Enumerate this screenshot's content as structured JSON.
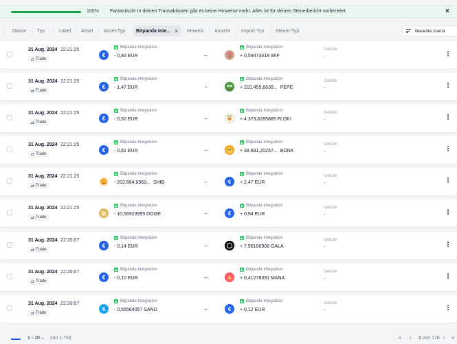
{
  "banner": {
    "progress_percent": 100,
    "progress_label": "100%",
    "message": "Fantastisch! In deinen Transaktionen gibt es keine Hinweise mehr. Alles ist für deinen Steuerbericht vorbereitet.",
    "close": "×"
  },
  "filters": {
    "items": [
      "Datum",
      "Typ",
      "Label",
      "Asset",
      "Asset-Typ"
    ],
    "active": {
      "label": "Bitpanda Inte...",
      "clear": "×"
    },
    "items_after": [
      "Hinweis",
      "Ansicht",
      "Import-Typ",
      "Steuer-Typ"
    ],
    "sort_label": "Neueste zuerst"
  },
  "common": {
    "source": "Bitpanda Integration",
    "tag": "Trade",
    "fee_label": "Gebühr",
    "fee_value": "-",
    "arrow": "→"
  },
  "rows": [
    {
      "date": "31 Aug. 2024",
      "time": "22:21:25",
      "from_icon": "EUR",
      "from_amount": "- 0,83 EUR",
      "from_sym": "",
      "to_icon": "WIF",
      "to_amount": "+ 0,59473418 WIF",
      "to_sym": ""
    },
    {
      "date": "31 Aug. 2024",
      "time": "22:21:25",
      "from_icon": "EUR",
      "from_amount": "- 1,47 EUR",
      "from_sym": "",
      "to_icon": "PEPE",
      "to_amount": "+ 210.455,6635...",
      "to_sym": "PEPE"
    },
    {
      "date": "31 Aug. 2024",
      "time": "22:21:25",
      "from_icon": "EUR",
      "from_amount": "- 0,50 EUR",
      "from_sym": "",
      "to_icon": "FLOKI",
      "to_amount": "+ 4.373,6285885 FLOKI",
      "to_sym": ""
    },
    {
      "date": "31 Aug. 2024",
      "time": "22:21:25",
      "from_icon": "EUR",
      "from_amount": "- 0,61 EUR",
      "from_sym": "",
      "to_icon": "BONK",
      "to_amount": "+ 38.691,20257...",
      "to_sym": "BONK"
    },
    {
      "date": "31 Aug. 2024",
      "time": "22:21:25",
      "from_icon": "SHIB",
      "from_amount": "- 202.684,0563...",
      "from_sym": "SHIB",
      "to_icon": "EUR",
      "to_amount": "+ 2,47 EUR",
      "to_sym": ""
    },
    {
      "date": "31 Aug. 2024",
      "time": "22:21:25",
      "from_icon": "DOGE",
      "from_amount": "- 10,56923995 DOGE",
      "from_sym": "",
      "to_icon": "EUR",
      "to_amount": "+ 0,94 EUR",
      "to_sym": ""
    },
    {
      "date": "31 Aug. 2024",
      "time": "22:20:07",
      "from_icon": "EUR",
      "from_amount": "- 0,14 EUR",
      "from_sym": "",
      "to_icon": "GALA",
      "to_amount": "+ 7,96196908 GALA",
      "to_sym": ""
    },
    {
      "date": "31 Aug. 2024",
      "time": "22:20:07",
      "from_icon": "EUR",
      "from_amount": "- 0,10 EUR",
      "from_sym": "",
      "to_icon": "MANA",
      "to_amount": "+ 0,41278391 MANA",
      "to_sym": ""
    },
    {
      "date": "31 Aug. 2024",
      "time": "22:20:07",
      "from_icon": "SAND",
      "from_amount": "- 0,55564057 SAND",
      "from_sym": "",
      "to_icon": "EUR",
      "to_amount": "+ 0,12 EUR",
      "to_sym": ""
    }
  ],
  "footer": {
    "per_page": "1 - 10",
    "per_page_chevron": "⌄",
    "range": "von 1.754",
    "first": "«",
    "prev": "‹",
    "page": "1",
    "page_of": "von 176",
    "next": "›",
    "last": "»"
  },
  "colors": {
    "accent": "#2563eb",
    "success": "#16a34a",
    "banner_bg": "#e8f7ef"
  }
}
